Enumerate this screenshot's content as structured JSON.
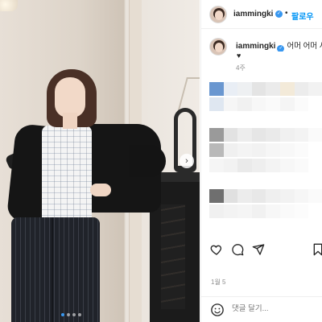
{
  "post": {
    "carousel": {
      "slide_count": 4,
      "active_index": 0,
      "next_icon": "chevron-right-icon"
    }
  },
  "header": {
    "username": "iammingki",
    "verified_icon": "verified-badge-icon",
    "separator": "•",
    "follow_label": "팔로우"
  },
  "caption": {
    "username": "iammingki",
    "text": "어머 어머 사",
    "emoji": "♥",
    "time_ago": "4주"
  },
  "actions": {
    "like_icon": "heart-icon",
    "comment_icon": "comment-icon",
    "share_icon": "send-icon",
    "save_icon": "bookmark-icon"
  },
  "likes": {
    "date": "1월 5"
  },
  "comment": {
    "emoji_icon": "smiley-icon",
    "placeholder": "댓글 달기..."
  },
  "colors": {
    "link_blue": "#0095f6",
    "verified_blue": "#3897f0",
    "muted_text": "#8e8e8e"
  }
}
